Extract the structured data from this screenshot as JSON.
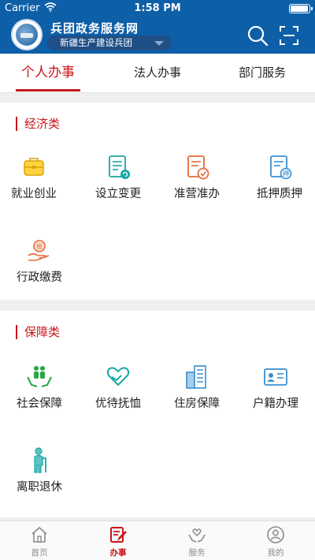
{
  "status_bar": {
    "carrier": "Carrier",
    "time": "1:58 PM",
    "battery_level": 1.0
  },
  "header": {
    "site_title": "兵团政务服务网",
    "region": "新疆生产建设兵团",
    "search_icon": "search-icon",
    "scan_icon": "scan-icon"
  },
  "tabs": [
    {
      "label": "个人办事",
      "active": true
    },
    {
      "label": "法人办事",
      "active": false
    },
    {
      "label": "部门服务",
      "active": false
    }
  ],
  "sections": [
    {
      "title": "经济类",
      "items": [
        {
          "label": "就业创业",
          "icon": "briefcase-icon",
          "color": "#f0b400"
        },
        {
          "label": "设立变更",
          "icon": "document-refresh-icon",
          "color": "#1aa5a5"
        },
        {
          "label": "准营准办",
          "icon": "document-check-icon",
          "color": "#e86a3a"
        },
        {
          "label": "抵押质押",
          "icon": "mortgage-document-icon",
          "color": "#3a8fd0"
        },
        {
          "label": "行政缴费",
          "icon": "tax-hand-icon",
          "color": "#e86a3a"
        }
      ]
    },
    {
      "title": "保障类",
      "items": [
        {
          "label": "社会保障",
          "icon": "family-hands-icon",
          "color": "#27a844"
        },
        {
          "label": "优待抚恤",
          "icon": "heart-hands-icon",
          "color": "#1aa5a5"
        },
        {
          "label": "住房保障",
          "icon": "buildings-icon",
          "color": "#3a8fd0"
        },
        {
          "label": "户籍办理",
          "icon": "id-card-icon",
          "color": "#3a8fd0"
        },
        {
          "label": "离职退休",
          "icon": "elderly-icon",
          "color": "#1aa5a5"
        }
      ]
    }
  ],
  "bottom_nav": [
    {
      "label": "首页",
      "icon": "home-icon",
      "active": false
    },
    {
      "label": "办事",
      "icon": "task-edit-icon",
      "active": true
    },
    {
      "label": "服务",
      "icon": "service-hands-icon",
      "active": false
    },
    {
      "label": "我的",
      "icon": "profile-icon",
      "active": false
    }
  ],
  "colors": {
    "brand_blue": "#0d5fa8",
    "accent_red": "#c8161d"
  }
}
